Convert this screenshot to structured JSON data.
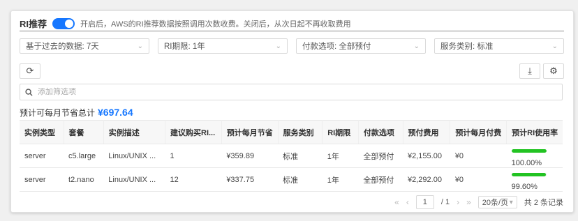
{
  "header": {
    "title": "RI推荐",
    "toggle_on": true,
    "hint": "开启后，AWS的RI推荐数据按照调用次数收费。关闭后，从次日起不再收取费用"
  },
  "filters": [
    {
      "label": "基于过去的数据: 7天"
    },
    {
      "label": "RI期限: 1年"
    },
    {
      "label": "付款选项: 全部预付"
    },
    {
      "label": "服务类别: 标准"
    }
  ],
  "search": {
    "placeholder": "添加筛选项"
  },
  "total": {
    "label": "预计可每月节省总计",
    "value": "¥697.64"
  },
  "table": {
    "columns": [
      "实例类型",
      "套餐",
      "实例描述",
      "建议购买RI...",
      "预计每月节省",
      "服务类别",
      "RI期限",
      "付款选项",
      "预付费用",
      "预计每月付费",
      "预计RI使用率"
    ],
    "rows": [
      {
        "type": "server",
        "plan": "c5.large",
        "desc": "Linux/UNIX ...",
        "qty": "1",
        "saving": "¥359.89",
        "cls": "标准",
        "term": "1年",
        "payment": "全部预付",
        "upfront": "¥2,155.00",
        "monthly": "¥0",
        "usage": "100.00%",
        "usage_fraction": 1.0
      },
      {
        "type": "server",
        "plan": "t2.nano",
        "desc": "Linux/UNIX ...",
        "qty": "12",
        "saving": "¥337.75",
        "cls": "标准",
        "term": "1年",
        "payment": "全部预付",
        "upfront": "¥2,292.00",
        "monthly": "¥0",
        "usage": "99.60%",
        "usage_fraction": 0.996
      }
    ]
  },
  "pagination": {
    "current_page": "1",
    "total_pages": "/ 1",
    "page_size": "20条/页",
    "total": "共 2 条记录"
  },
  "colors": {
    "accent": "#1677ff",
    "usage_bar": "#22c322"
  }
}
